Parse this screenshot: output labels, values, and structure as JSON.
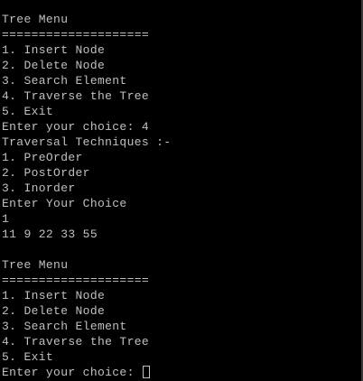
{
  "console": {
    "lines": [
      "Tree Menu",
      "====================",
      "1. Insert Node",
      "2. Delete Node",
      "3. Search Element",
      "4. Traverse the Tree",
      "5. Exit",
      "Enter your choice: 4",
      "Traversal Techniques :-",
      "1. PreOrder",
      "2. PostOrder",
      "3. Inorder",
      "Enter Your Choice",
      "1",
      "11 9 22 33 55",
      "",
      "Tree Menu",
      "====================",
      "1. Insert Node",
      "2. Delete Node",
      "3. Search Element",
      "4. Traverse the Tree",
      "5. Exit"
    ],
    "prompt": "Enter your choice: "
  },
  "colors": {
    "background": "#000000",
    "text": "#c0c0c0"
  }
}
